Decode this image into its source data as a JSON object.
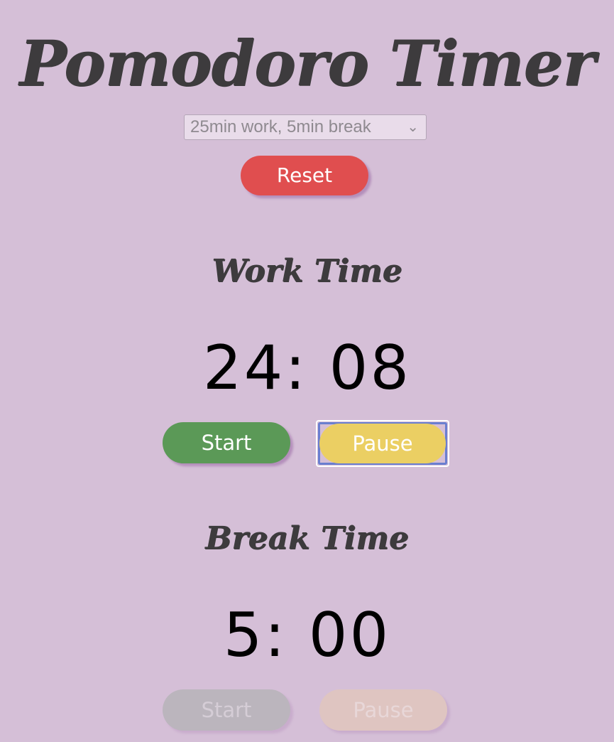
{
  "app": {
    "title": "Pomodoro Timer"
  },
  "preset": {
    "selected": "25min work, 5min break",
    "chevron_icon": "chevron-down-icon"
  },
  "controls": {
    "reset_label": "Reset"
  },
  "work": {
    "heading": "Work Time",
    "time": "24: 08",
    "start_label": "Start",
    "pause_label": "Pause"
  },
  "break": {
    "heading": "Break Time",
    "time": "5: 00",
    "start_label": "Start",
    "pause_label": "Pause"
  },
  "colors": {
    "background": "#d5bfd7",
    "reset": "#e04e4f",
    "start": "#5b9957",
    "pause": "#ebcf63",
    "focus_ring": "#6a7fd0"
  }
}
